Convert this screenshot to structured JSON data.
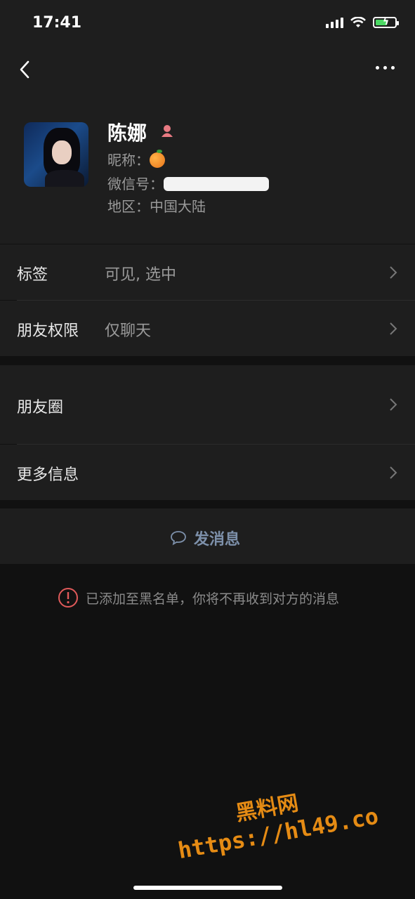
{
  "status_bar": {
    "time": "17:41"
  },
  "profile": {
    "name": "陈娜",
    "nickname_label": "昵称：",
    "wechat_id_label": "微信号：",
    "region_label": "地区：",
    "region_value": "中国大陆"
  },
  "rows": [
    {
      "label": "标签",
      "value": "可见, 选中"
    },
    {
      "label": "朋友权限",
      "value": "仅聊天"
    },
    {
      "label": "朋友圈",
      "value": ""
    },
    {
      "label": "更多信息",
      "value": ""
    }
  ],
  "send_message": {
    "label": "发消息"
  },
  "blacklist_notice": "已添加至黑名单，你将不再收到对方的消息",
  "watermark": {
    "title": "黑料网",
    "url": "https://hl49.co"
  },
  "colors": {
    "accent": "#7d90aa",
    "warning": "#e05a5a",
    "watermark": "#e58b14"
  }
}
